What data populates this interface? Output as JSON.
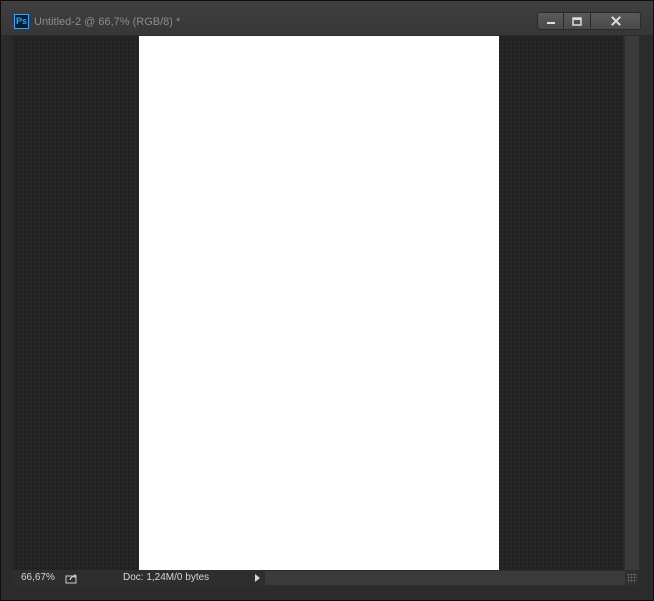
{
  "window": {
    "app_icon_label": "Ps",
    "title": "Untitled-2 @ 66,7% (RGB/8) *",
    "buttons": {
      "minimize_icon": "minimize-icon",
      "maximize_icon": "maximize-icon",
      "close_icon": "close-icon"
    }
  },
  "canvas": {
    "background_color": "#222222",
    "document_color": "#ffffff"
  },
  "statusbar": {
    "zoom": "66,67%",
    "share_icon": "share-icon",
    "doc_info": "Doc: 1,24M/0 bytes"
  },
  "colors": {
    "accent": "#31a8ff",
    "window_bg": "#2b2b2b"
  }
}
